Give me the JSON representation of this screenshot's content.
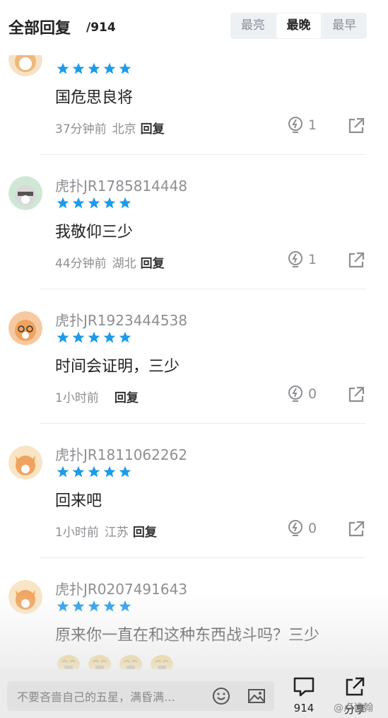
{
  "header": {
    "title": "全部回复",
    "count": "/914",
    "sort_tabs": [
      "最亮",
      "最晚",
      "最早"
    ],
    "active_sort": "最晚"
  },
  "comments": [
    {
      "username": "",
      "rating": 5,
      "content": "国危思良将",
      "time": "37分钟前",
      "location": "北京",
      "reply_label": "回复",
      "likes": "1"
    },
    {
      "username": "虎扑JR1785814448",
      "rating": 5,
      "content": "我敬仰三少",
      "time": "44分钟前",
      "location": "湖北",
      "reply_label": "回复",
      "likes": "1"
    },
    {
      "username": "虎扑JR1923444538",
      "rating": 5,
      "content": "时间会证明，三少",
      "time": "1小时前",
      "location": "",
      "reply_label": "回复",
      "likes": "0"
    },
    {
      "username": "虎扑JR1811062262",
      "rating": 5,
      "content": "回来吧",
      "time": "1小时前",
      "location": "江苏",
      "reply_label": "回复",
      "likes": "0"
    },
    {
      "username": "虎扑JR0207491643",
      "rating": 5,
      "content": "原来你一直在和这种东西战斗吗？三少",
      "emoji_count": 4
    }
  ],
  "bottom_bar": {
    "input_placeholder": "不要吝啬自己的五星，满昏满…",
    "comment_count": "914",
    "share_label": "分享"
  },
  "watermark": "@卢诗翰",
  "colors": {
    "star": "#1e9be8",
    "accent": "#222222",
    "muted": "#8e8e93"
  }
}
